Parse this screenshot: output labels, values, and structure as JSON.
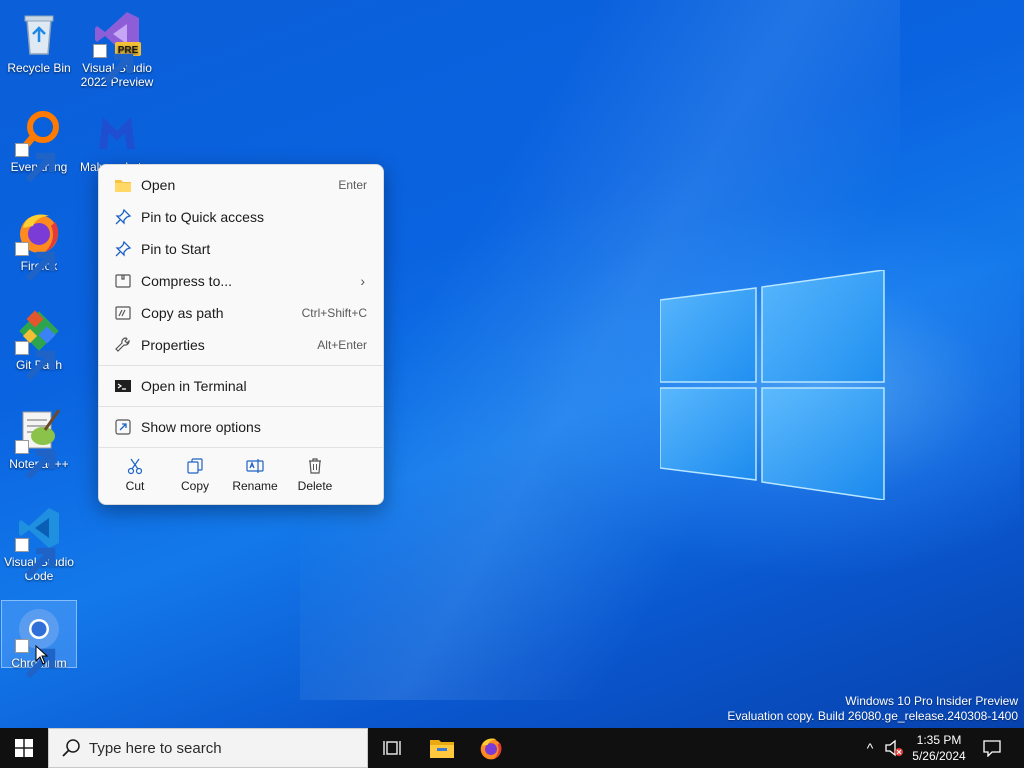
{
  "desktop": {
    "icons": [
      {
        "label": "Recycle Bin",
        "icon": "recycle-bin-icon"
      },
      {
        "label": "Visual Studio 2022 Preview",
        "icon": "visual-studio-icon",
        "badge": "PRE"
      },
      {
        "label": "Everything",
        "icon": "everything-search-icon"
      },
      {
        "label": "Malwarebytes",
        "icon": "malwarebytes-icon"
      },
      {
        "label": "Firefox",
        "icon": "firefox-icon"
      },
      {
        "label": "Git Bash",
        "icon": "git-bash-icon"
      },
      {
        "label": "Notepad++",
        "icon": "notepad-plus-plus-icon"
      },
      {
        "label": "Visual Studio Code",
        "icon": "vscode-icon"
      },
      {
        "label": "Chromium",
        "icon": "chromium-icon",
        "selected": true
      }
    ]
  },
  "context_menu": {
    "items": [
      {
        "label": "Open",
        "shortcut": "Enter",
        "icon": "folder-icon"
      },
      {
        "label": "Pin to Quick access",
        "icon": "pin-icon"
      },
      {
        "label": "Pin to Start",
        "icon": "pin-icon"
      },
      {
        "label": "Compress to...",
        "icon": "zip-icon",
        "submenu": true
      },
      {
        "label": "Copy as path",
        "shortcut": "Ctrl+Shift+C",
        "icon": "copy-path-icon"
      },
      {
        "label": "Properties",
        "shortcut": "Alt+Enter",
        "icon": "wrench-icon"
      },
      {
        "label": "Open in Terminal",
        "icon": "terminal-icon"
      },
      {
        "label": "Show more options",
        "icon": "more-options-icon"
      }
    ],
    "actions": [
      {
        "label": "Cut",
        "icon": "scissors-icon"
      },
      {
        "label": "Copy",
        "icon": "copy-icon"
      },
      {
        "label": "Rename",
        "icon": "rename-icon"
      },
      {
        "label": "Delete",
        "icon": "trash-icon"
      }
    ],
    "submenu_arrow": "›"
  },
  "watermark": {
    "line1": "Windows 10 Pro Insider Preview",
    "line2": "Evaluation copy. Build 26080.ge_release.240308-1400"
  },
  "taskbar": {
    "search_placeholder": "Type here to search",
    "clock_time": "1:35 PM",
    "clock_date": "5/26/2024",
    "tray_chevron": "^"
  },
  "colors": {
    "accent": "#0078d4",
    "taskbar": "#101010",
    "menu_bg": "#f9f9f9"
  }
}
